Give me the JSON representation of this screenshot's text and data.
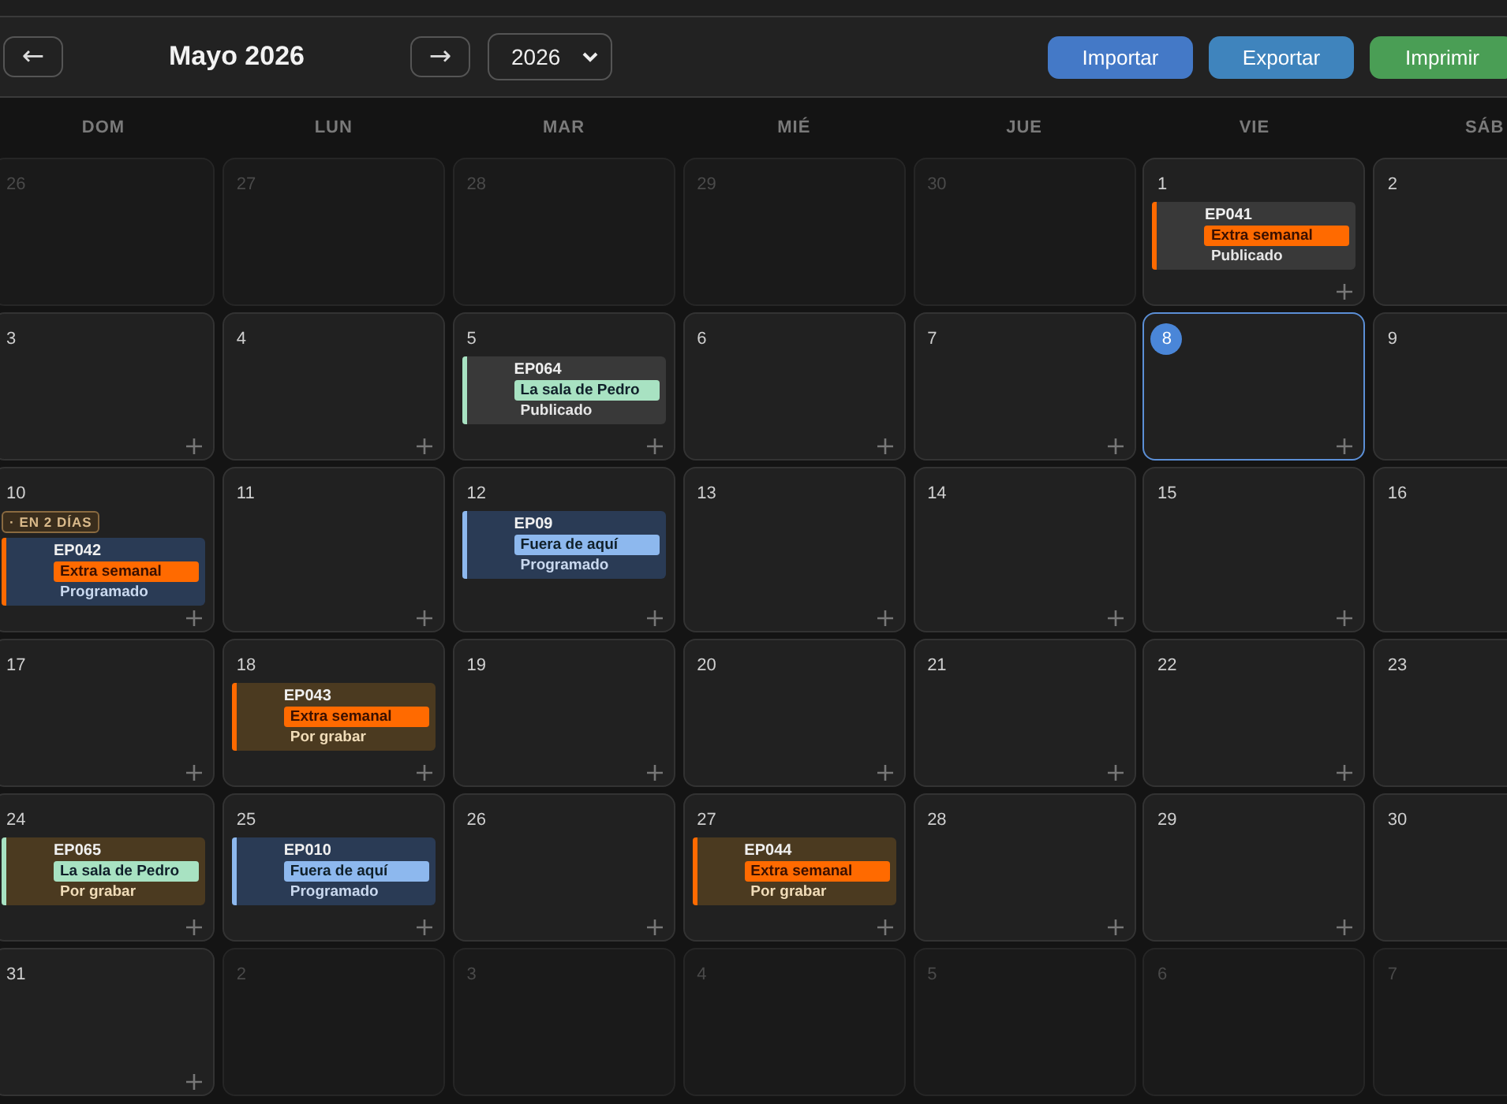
{
  "toolbar": {
    "prev": "←",
    "title": "Mayo 2026",
    "next": "→",
    "year": "2026",
    "actions": [
      {
        "label": "Importar",
        "kind": "import"
      },
      {
        "label": "Exportar",
        "kind": "export"
      },
      {
        "label": "Imprimir",
        "kind": "print"
      }
    ]
  },
  "weekdays": [
    "DOM",
    "LUN",
    "MAR",
    "MIÉ",
    "JUE",
    "VIE",
    "SÁB"
  ],
  "weeks": [
    [
      {
        "day": "26",
        "in_month": false
      },
      {
        "day": "27",
        "in_month": false
      },
      {
        "day": "28",
        "in_month": false
      },
      {
        "day": "29",
        "in_month": false
      },
      {
        "day": "30",
        "in_month": false
      },
      {
        "day": "1",
        "in_month": true,
        "events": [
          {
            "code": "EP041",
            "show": "Extra semanal",
            "color": "#ff6a00",
            "status": "Publicado",
            "kind": "published"
          }
        ]
      },
      {
        "day": "2",
        "in_month": true
      }
    ],
    [
      {
        "day": "3",
        "in_month": true
      },
      {
        "day": "4",
        "in_month": true
      },
      {
        "day": "5",
        "in_month": true,
        "events": [
          {
            "code": "EP064",
            "show": "La sala de Pedro",
            "color": "#a8e2c2",
            "status": "Publicado",
            "kind": "published"
          }
        ]
      },
      {
        "day": "6",
        "in_month": true
      },
      {
        "day": "7",
        "in_month": true
      },
      {
        "day": "8",
        "in_month": true,
        "today": true
      },
      {
        "day": "9",
        "in_month": true
      }
    ],
    [
      {
        "day": "10",
        "in_month": true,
        "badge": "· EN 2 DÍAS",
        "events": [
          {
            "code": "EP042",
            "show": "Extra semanal",
            "color": "#ff6a00",
            "status": "Programado",
            "kind": "scheduled"
          }
        ]
      },
      {
        "day": "11",
        "in_month": true
      },
      {
        "day": "12",
        "in_month": true,
        "events": [
          {
            "code": "EP09",
            "show": "Fuera de aquí",
            "color": "#8db8ee",
            "status": "Programado",
            "kind": "scheduled"
          }
        ]
      },
      {
        "day": "13",
        "in_month": true
      },
      {
        "day": "14",
        "in_month": true
      },
      {
        "day": "15",
        "in_month": true
      },
      {
        "day": "16",
        "in_month": true
      }
    ],
    [
      {
        "day": "17",
        "in_month": true
      },
      {
        "day": "18",
        "in_month": true,
        "events": [
          {
            "code": "EP043",
            "show": "Extra semanal",
            "color": "#ff6a00",
            "status": "Por grabar",
            "kind": "to-record"
          }
        ]
      },
      {
        "day": "19",
        "in_month": true
      },
      {
        "day": "20",
        "in_month": true
      },
      {
        "day": "21",
        "in_month": true
      },
      {
        "day": "22",
        "in_month": true
      },
      {
        "day": "23",
        "in_month": true
      }
    ],
    [
      {
        "day": "24",
        "in_month": true,
        "events": [
          {
            "code": "EP065",
            "show": "La sala de Pedro",
            "color": "#a8e2c2",
            "status": "Por grabar",
            "kind": "to-record"
          }
        ]
      },
      {
        "day": "25",
        "in_month": true,
        "events": [
          {
            "code": "EP010",
            "show": "Fuera de aquí",
            "color": "#8db8ee",
            "status": "Programado",
            "kind": "scheduled"
          }
        ]
      },
      {
        "day": "26",
        "in_month": true
      },
      {
        "day": "27",
        "in_month": true,
        "events": [
          {
            "code": "EP044",
            "show": "Extra semanal",
            "color": "#ff6a00",
            "status": "Por grabar",
            "kind": "to-record"
          }
        ]
      },
      {
        "day": "28",
        "in_month": true
      },
      {
        "day": "29",
        "in_month": true
      },
      {
        "day": "30",
        "in_month": true
      }
    ],
    [
      {
        "day": "31",
        "in_month": true
      },
      {
        "day": "2",
        "in_month": false
      },
      {
        "day": "3",
        "in_month": false
      },
      {
        "day": "4",
        "in_month": false
      },
      {
        "day": "5",
        "in_month": false
      },
      {
        "day": "6",
        "in_month": false
      },
      {
        "day": "7",
        "in_month": false
      }
    ]
  ]
}
